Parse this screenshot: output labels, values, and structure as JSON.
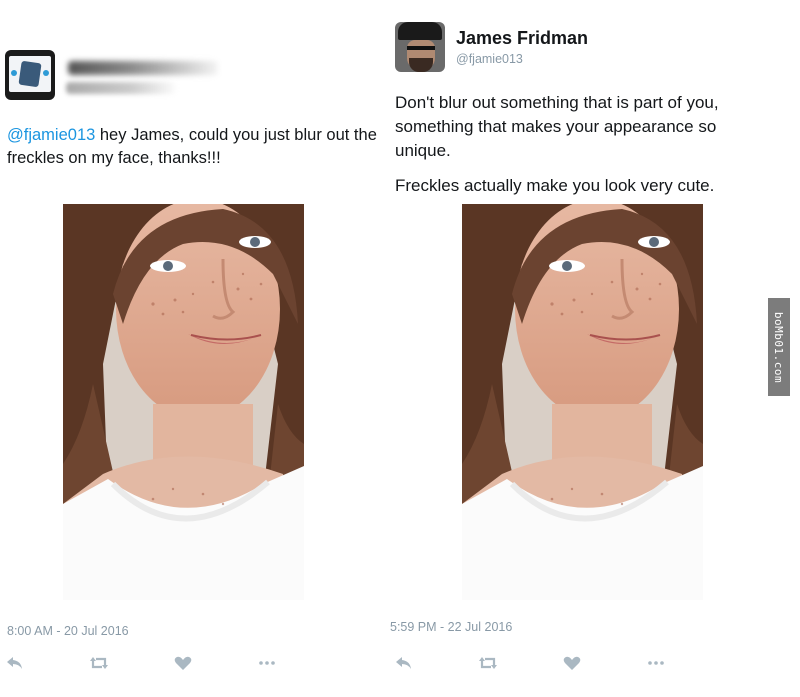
{
  "request_tweet": {
    "author_handle_visible": "@fi",
    "mention": "@fjamie013",
    "text": " hey James, could you just blur out the freckles on my face, thanks!!!",
    "timestamp": "8:00 AM - 20 Jul 2016"
  },
  "reply_tweet": {
    "author_name": "James Fridman",
    "author_handle": "@fjamie013",
    "text_paragraph_1": "Don't blur out something that is part of you, something that makes your appearance so unique.",
    "text_paragraph_2": "Freckles actually make you look very cute.",
    "timestamp": "5:59 PM - 22 Jul 2016"
  },
  "actions": {
    "icons": [
      "reply-icon",
      "retweet-icon",
      "like-icon",
      "more-icon"
    ],
    "icon_color": "#aab8c2"
  },
  "watermark": {
    "text": "boMb01.com"
  },
  "colors": {
    "mention": "#1b95e0",
    "text": "#14171a",
    "meta": "#8899a6"
  }
}
